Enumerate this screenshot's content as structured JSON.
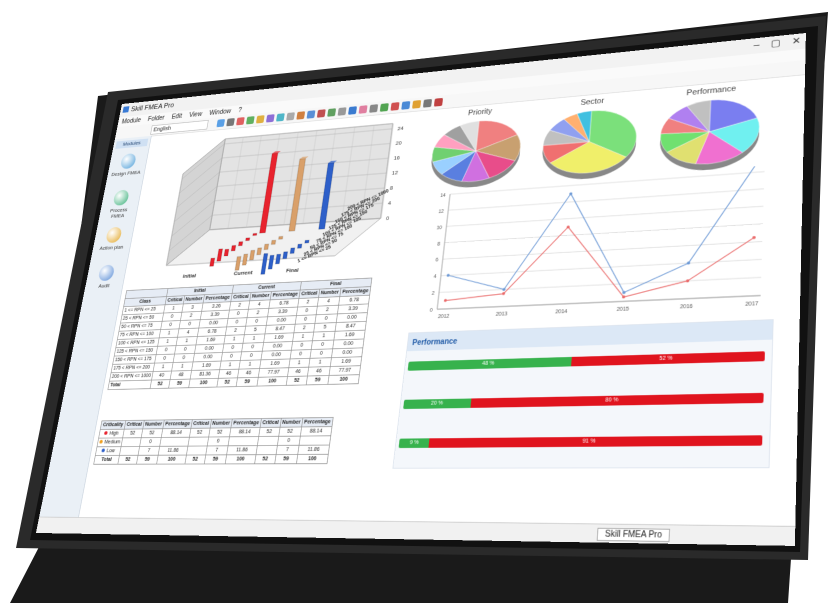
{
  "window": {
    "title": "Skill FMEA Pro",
    "controls": [
      "–",
      "▢",
      "✕"
    ]
  },
  "menu": [
    "Module",
    "Folder",
    "Edit",
    "View",
    "Window",
    "?"
  ],
  "toolbar": {
    "language": "English"
  },
  "sidebar": {
    "tab": "Modules",
    "items": [
      {
        "label": "Design FMEA",
        "icon": "design-fmea-icon",
        "color": "#4f9fd8"
      },
      {
        "label": "Process FMEA",
        "icon": "process-fmea-icon",
        "color": "#3ab07a"
      },
      {
        "label": "Action plan",
        "icon": "action-plan-icon",
        "color": "#e3a82b"
      },
      {
        "label": "Audit",
        "icon": "audit-icon",
        "color": "#5b8ed6"
      }
    ]
  },
  "chart3d": {
    "categories": [
      "Initial",
      "Current",
      "Final"
    ],
    "rpm_ranges": [
      "200 < RPN <= 1000",
      "175 < RPN <= 200",
      "150 < RPN <= 175",
      "125 < RPN <= 150",
      "100 < RPN <= 125",
      "75 < RPN <= 100",
      "50 < RPN <= 75",
      "25 < RPN <= 50",
      "1 <= RPN <= 25"
    ],
    "z_ticks": [
      "0",
      "4",
      "8",
      "12",
      "16",
      "20",
      "24"
    ],
    "series_colors": [
      "#e8232e",
      "#d9a06a",
      "#2d5fc9"
    ]
  },
  "rpn_table": {
    "group_headers": [
      "Initial",
      "Current",
      "Final"
    ],
    "col_headers": [
      "Class",
      "Critical",
      "Number",
      "Percentage",
      "Critical",
      "Number",
      "Percentage",
      "Critical",
      "Number",
      "Percentage"
    ],
    "rows": [
      [
        "1 <= RPN <= 25",
        "1",
        "3",
        "3.26",
        "2",
        "4",
        "6.78",
        "2",
        "4",
        "6.78"
      ],
      [
        "25 < RPN <= 50",
        "0",
        "2",
        "3.39",
        "0",
        "2",
        "3.39",
        "0",
        "2",
        "3.39"
      ],
      [
        "50 < RPN <= 75",
        "0",
        "0",
        "0.00",
        "0",
        "0",
        "0.00",
        "0",
        "0",
        "0.00"
      ],
      [
        "75 < RPN <= 100",
        "1",
        "4",
        "6.78",
        "2",
        "5",
        "8.47",
        "2",
        "5",
        "8.47"
      ],
      [
        "100 < RPN <= 125",
        "1",
        "1",
        "1.69",
        "1",
        "1",
        "1.69",
        "1",
        "1",
        "1.69"
      ],
      [
        "125 < RPN <= 150",
        "0",
        "0",
        "0.00",
        "0",
        "0",
        "0.00",
        "0",
        "0",
        "0.00"
      ],
      [
        "150 < RPN <= 175",
        "0",
        "0",
        "0.00",
        "0",
        "0",
        "0.00",
        "0",
        "0",
        "0.00"
      ],
      [
        "175 < RPN <= 200",
        "1",
        "1",
        "1.69",
        "1",
        "1",
        "1.69",
        "1",
        "1",
        "1.69"
      ],
      [
        "200 < RPN <= 1000",
        "40",
        "48",
        "81.36",
        "46",
        "46",
        "77.97",
        "46",
        "46",
        "77.97"
      ],
      [
        "Total",
        "52",
        "59",
        "100",
        "52",
        "59",
        "100",
        "52",
        "59",
        "100"
      ]
    ]
  },
  "crit_table": {
    "col_headers": [
      "Criticality",
      "Critical",
      "Number",
      "Percentage",
      "Critical",
      "Number",
      "Percentage",
      "Critical",
      "Number",
      "Percentage"
    ],
    "rows": [
      [
        "High",
        "52",
        "52",
        "88.14",
        "52",
        "52",
        "88.14",
        "52",
        "52",
        "88.14"
      ],
      [
        "Medium",
        "",
        "0",
        "",
        "",
        "0",
        "",
        "",
        "0",
        ""
      ],
      [
        "Low",
        "",
        "7",
        "11.86",
        "",
        "7",
        "11.86",
        "",
        "7",
        "11.86"
      ],
      [
        "Total",
        "52",
        "59",
        "100",
        "52",
        "59",
        "100",
        "52",
        "59",
        "100"
      ]
    ],
    "dot_colors": [
      "#e8232e",
      "#f0a020",
      "#2d5fc9"
    ]
  },
  "pies": [
    {
      "title": "Priority",
      "values": [
        18,
        14,
        12,
        10,
        9,
        8,
        8,
        7,
        7,
        7
      ],
      "colors": [
        "#f08080",
        "#c8a070",
        "#e84d8a",
        "#d070e0",
        "#5a7fe0",
        "#9ad0ff",
        "#70d070",
        "#ffa0c0",
        "#a0a0a0",
        "#e0e0e0"
      ]
    },
    {
      "title": "Sector",
      "values": [
        35,
        30,
        10,
        8,
        7,
        5,
        5
      ],
      "colors": [
        "#7be07b",
        "#f0ef6a",
        "#f07070",
        "#c0c0c0",
        "#90a0f0",
        "#ffb070",
        "#40c0e0"
      ]
    },
    {
      "title": "Performance",
      "values": [
        20,
        18,
        16,
        12,
        10,
        8,
        8,
        8
      ],
      "colors": [
        "#7a7ef0",
        "#70f0f0",
        "#f070d0",
        "#e0e070",
        "#70e070",
        "#f08080",
        "#b080f0",
        "#c0c0c0"
      ]
    }
  ],
  "line_chart": {
    "type": "line",
    "x": [
      "2012",
      "2013",
      "2014",
      "2015",
      "2016",
      "2017"
    ],
    "y_ticks": [
      "0",
      "2",
      "4",
      "6",
      "8",
      "10",
      "12",
      "14"
    ],
    "ylim": [
      0,
      14
    ],
    "series": [
      {
        "values": [
          4,
          2,
          13,
          1,
          4,
          15
        ],
        "color": "#6e9ad6"
      },
      {
        "values": [
          1,
          1.5,
          9,
          0.5,
          2,
          6.5
        ],
        "color": "#ea6b6b"
      }
    ]
  },
  "performance": {
    "title": "Performance",
    "bars": [
      {
        "value": 48,
        "left_label": "48 %",
        "right_label": "52 %"
      },
      {
        "value": 20,
        "left_label": "20 %",
        "right_label": "80 %"
      },
      {
        "value": 9,
        "left_label": "9 %",
        "right_label": "91 %"
      }
    ]
  },
  "status": {
    "text": "Skill FMEA Pro"
  }
}
